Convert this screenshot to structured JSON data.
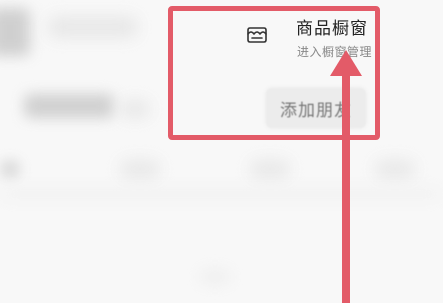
{
  "popup": {
    "store_title": "商品橱窗",
    "store_subtitle": "进入橱窗管理",
    "add_friend_label": "添加朋友"
  },
  "icons": {
    "store": "store-icon"
  },
  "colors": {
    "highlight": "#e35b68",
    "background": "#f8f8f8"
  }
}
